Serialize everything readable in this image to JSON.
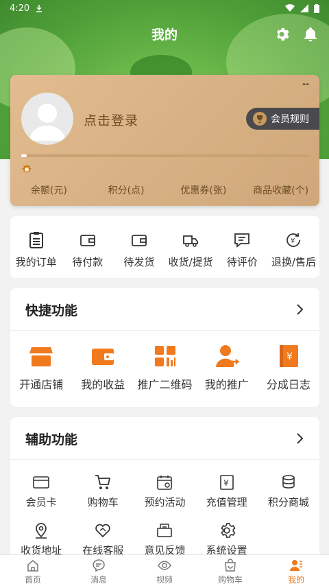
{
  "status_bar": {
    "time": "4:20"
  },
  "header": {
    "title": "我的"
  },
  "profile": {
    "login_prompt": "点击登录",
    "member_rules": "会员规则",
    "progress": 0.02,
    "stats": [
      "余额(元)",
      "积分(点)",
      "优惠券(张)",
      "商品收藏(个)"
    ]
  },
  "orders": [
    {
      "label": "我的订单",
      "icon": "order-list-icon"
    },
    {
      "label": "待付款",
      "icon": "wallet-icon"
    },
    {
      "label": "待发货",
      "icon": "wallet-icon"
    },
    {
      "label": "收货/提货",
      "icon": "truck-icon"
    },
    {
      "label": "待评价",
      "icon": "comment-icon"
    },
    {
      "label": "退换/售后",
      "icon": "refund-icon"
    }
  ],
  "quick": {
    "title": "快捷功能",
    "items": [
      {
        "label": "开通店铺",
        "icon": "shop-icon"
      },
      {
        "label": "我的收益",
        "icon": "wallet-icon"
      },
      {
        "label": "推广二维码",
        "icon": "qrcode-icon"
      },
      {
        "label": "我的推广",
        "icon": "user-share-icon"
      },
      {
        "label": "分成日志",
        "icon": "ledger-icon"
      }
    ]
  },
  "aux": {
    "title": "辅助功能",
    "items": [
      {
        "label": "会员卡",
        "icon": "vip-card-icon"
      },
      {
        "label": "购物车",
        "icon": "cart-icon"
      },
      {
        "label": "预约活动",
        "icon": "calendar-icon"
      },
      {
        "label": "充值管理",
        "icon": "recharge-icon"
      },
      {
        "label": "积分商城",
        "icon": "coins-icon"
      },
      {
        "label": "收货地址",
        "icon": "location-icon"
      },
      {
        "label": "在线客服",
        "icon": "handshake-icon"
      },
      {
        "label": "意见反馈",
        "icon": "feedback-icon"
      },
      {
        "label": "系统设置",
        "icon": "gear-icon"
      }
    ]
  },
  "tabbar": [
    {
      "label": "首页",
      "icon": "home-icon"
    },
    {
      "label": "消息",
      "icon": "message-icon"
    },
    {
      "label": "视频",
      "icon": "eye-icon"
    },
    {
      "label": "购物车",
      "icon": "cart-icon"
    },
    {
      "label": "我的",
      "icon": "profile-icon",
      "active": true
    }
  ],
  "colors": {
    "accent": "#f07a1d",
    "card": "#d8b284",
    "hero": "#6bb84a"
  }
}
